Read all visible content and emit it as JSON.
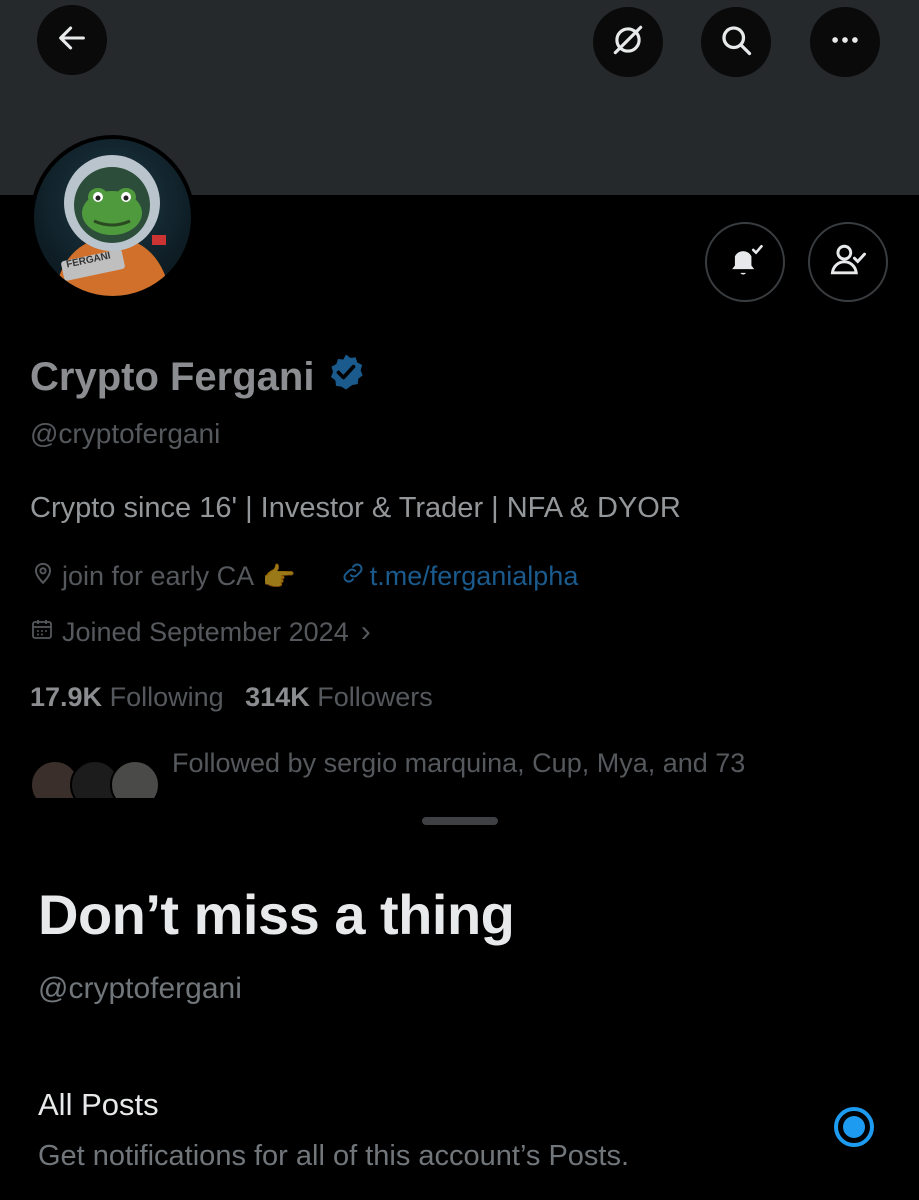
{
  "header": {
    "back_icon": "arrow-left-icon",
    "grok_icon": "grok-icon",
    "search_icon": "search-icon",
    "more_icon": "more-horizontal-icon"
  },
  "profile": {
    "display_name": "Crypto Fergani",
    "verified": true,
    "handle": "@cryptofergani",
    "bio": "Crypto since 16' | Investor & Trader | NFA & DYOR",
    "location": "join for early CA",
    "location_emoji": "👉",
    "link": "t.me/ferganialpha",
    "joined": "Joined September 2024",
    "joined_chevron": "›",
    "following_count": "17.9K",
    "following_label": "Following",
    "followers_count": "314K",
    "followers_label": "Followers",
    "followed_by": "Followed by sergio marquina, Cup, Mya, and 73",
    "avatar_badge": "FERGANI"
  },
  "sheet": {
    "title": "Don’t miss a thing",
    "handle": "@cryptofergani",
    "option_title": "All Posts",
    "option_desc": "Get notifications for all of this account’s Posts.",
    "option_selected": true
  },
  "colors": {
    "accent": "#1d9bf0",
    "verified": "#1d9bf0",
    "banner": "#26292c",
    "background": "#000000"
  }
}
